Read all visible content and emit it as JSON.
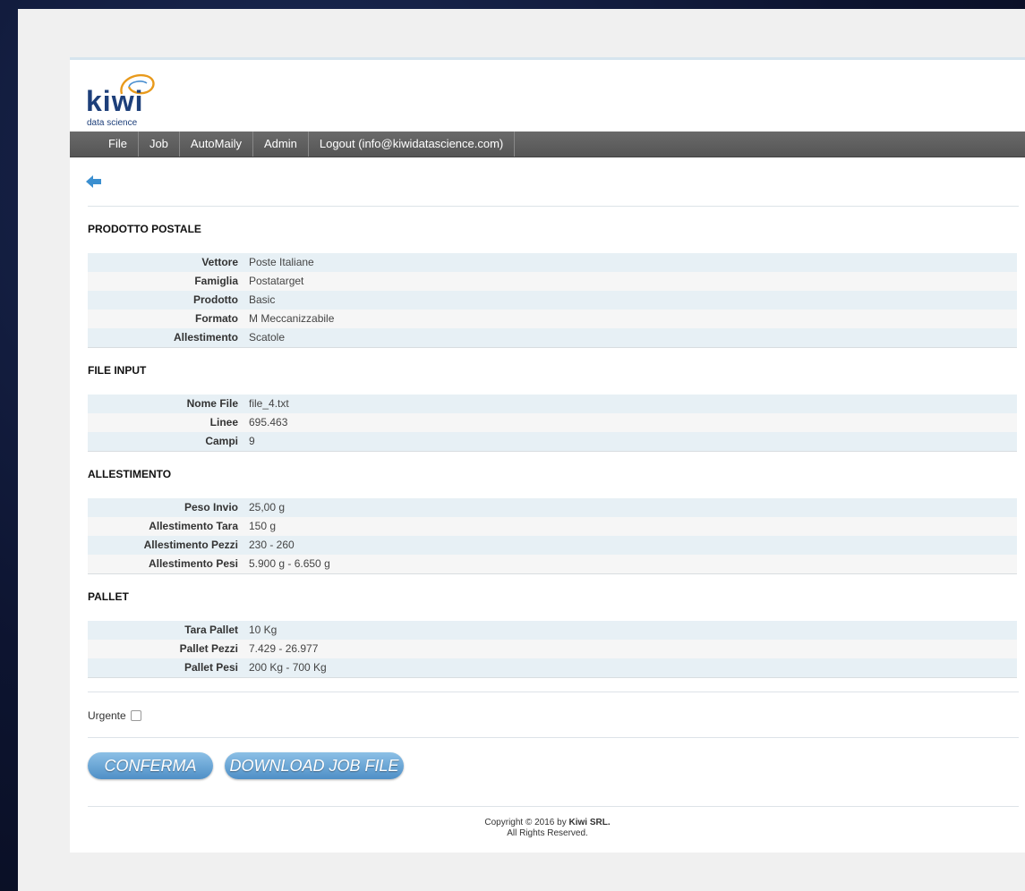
{
  "brand": {
    "name": "kiwi",
    "tagline": "data science"
  },
  "nav": [
    "File",
    "Job",
    "AutoMaily",
    "Admin",
    "Logout (info@kiwidatascience.com)"
  ],
  "sections": {
    "prodotto": {
      "title": "PRODOTTO POSTALE",
      "rows": [
        {
          "k": "Vettore",
          "v": "Poste Italiane"
        },
        {
          "k": "Famiglia",
          "v": "Postatarget"
        },
        {
          "k": "Prodotto",
          "v": "Basic"
        },
        {
          "k": "Formato",
          "v": "M Meccanizzabile"
        },
        {
          "k": "Allestimento",
          "v": "Scatole"
        }
      ]
    },
    "file": {
      "title": "FILE INPUT",
      "rows": [
        {
          "k": "Nome File",
          "v": "file_4.txt"
        },
        {
          "k": "Linee",
          "v": "695.463"
        },
        {
          "k": "Campi",
          "v": "9"
        }
      ]
    },
    "allestimento": {
      "title": "ALLESTIMENTO",
      "rows": [
        {
          "k": "Peso Invio",
          "v": "25,00 g"
        },
        {
          "k": "Allestimento Tara",
          "v": "150 g"
        },
        {
          "k": "Allestimento Pezzi",
          "v": "230 - 260"
        },
        {
          "k": "Allestimento Pesi",
          "v": "5.900 g - 6.650 g"
        }
      ]
    },
    "pallet": {
      "title": "PALLET",
      "rows": [
        {
          "k": "Tara Pallet",
          "v": "10 Kg"
        },
        {
          "k": "Pallet Pezzi",
          "v": "7.429 - 26.977"
        },
        {
          "k": "Pallet Pesi",
          "v": "200 Kg - 700 Kg"
        }
      ]
    }
  },
  "urgent_label": "Urgente",
  "urgent_checked": false,
  "buttons": {
    "confirm": "CONFERMA",
    "download": "DOWNLOAD JOB FILE"
  },
  "footer": {
    "copyright": "Copyright © 2016 by",
    "company": "Kiwi SRL.",
    "rights": "All Rights Reserved."
  },
  "colors": {
    "accent": "#4f8fc6",
    "brand": "#1d3f7a",
    "navbar": "#5e5e5e"
  }
}
